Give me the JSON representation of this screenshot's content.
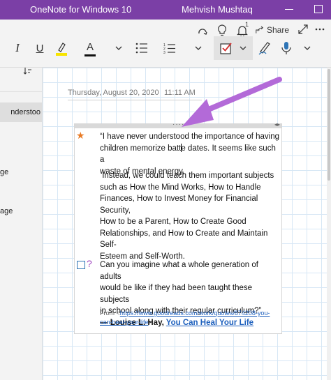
{
  "window": {
    "app_title": "OneNote for Windows 10",
    "user_name": "Mehvish Mushtaq"
  },
  "toolbar_top": {
    "notification_count": "1",
    "share_label": "Share"
  },
  "toolbar": {
    "italic_label": "I",
    "underline_label": "U",
    "font_color_label": "A",
    "highlight_color": "#f7e400",
    "font_color": "#111111"
  },
  "sidebar": {
    "items": [
      {
        "label": "nderstoo"
      },
      {
        "label": "ge"
      },
      {
        "label": "age"
      }
    ]
  },
  "page": {
    "date": "Thursday, August 20, 2020",
    "time": "11:11 AM"
  },
  "note": {
    "para1_line1": "“I have never understood the importance of having",
    "para1_line2a": "children memorize batt",
    "para1_line2b": "e dates. It seems like such a",
    "para1_line3": "waste of mental energy.",
    "para2_lines": [
      " Instead, we could teach them important subjects",
      "such as How the Mind Works, How to Handle",
      "Finances, How to Invest Money for Financial Security,",
      "How to be a Parent, How to Create Good",
      "Relationships, and How to Create and Maintain Self-",
      "Esteem and Self-Worth."
    ],
    "para3_lines": [
      "Can you imagine what a whole generation of adults",
      "would be like if they had been taught these subjects",
      "in school along with their regular curriculum?”"
    ],
    "attribution_prefix": "— Louise L. Hay, ",
    "attribution_link": "You Can Heal Your Life",
    "source_prefix": "From <",
    "source_link_line1": "https://www.goodreads.com/work/quotes/874208-you-",
    "source_link_line2": "can-heal-your-life",
    "source_suffix": ">"
  },
  "colors": {
    "title_bar": "#7b3fa6",
    "star": "#e87a25",
    "annotation_arrow": "#b36ad8",
    "link": "#1c5fbd"
  }
}
